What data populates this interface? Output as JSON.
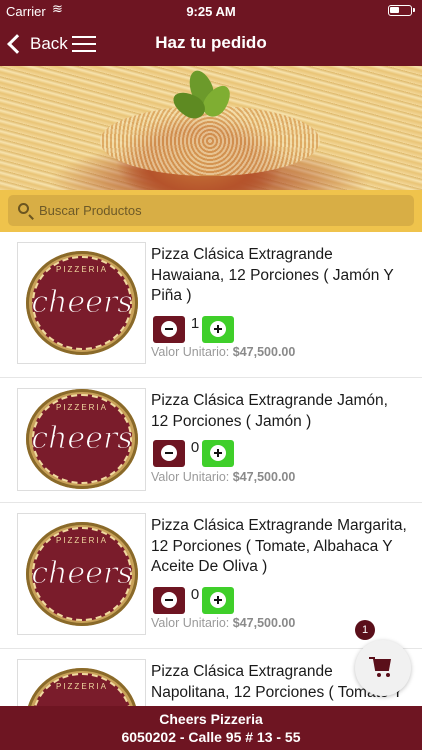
{
  "status_bar": {
    "carrier": "Carrier",
    "time": "9:25 AM",
    "wifi_icon": "wifi-icon",
    "battery_icon": "battery-icon"
  },
  "nav": {
    "back_label": "Back",
    "title": "Haz tu pedido"
  },
  "search": {
    "placeholder": "Buscar Productos"
  },
  "logo": {
    "text": "cheers",
    "subtext": "PIZZERIA"
  },
  "products": [
    {
      "name": "Pizza Clásica Extragrande Hawaiana, 12 Porciones ( Jamón Y Piña )",
      "quantity": "1",
      "price_label": "Valor Unitario:",
      "price": "$47,500.00"
    },
    {
      "name": "Pizza Clásica Extragrande Jamón, 12 Porciones ( Jamón )",
      "quantity": "0",
      "price_label": "Valor Unitario:",
      "price": "$47,500.00"
    },
    {
      "name": "Pizza Clásica Extragrande Margarita, 12 Porciones ( Tomate, Albahaca Y Aceite De Oliva )",
      "quantity": "0",
      "price_label": "Valor Unitario:",
      "price": "$47,500.00"
    },
    {
      "name": "Pizza Clásica Extragrande Napolitana, 12 Porciones ( Tomate Y",
      "quantity": "",
      "price_label": "",
      "price": ""
    }
  ],
  "cart": {
    "count": "1",
    "icon": "cart-icon"
  },
  "footer": {
    "line1": "Cheers Pizzeria",
    "line2": "6050202 - Calle 95 # 13 - 55"
  },
  "colors": {
    "primary": "#6e1522",
    "accent": "#efc34c",
    "plus": "#3fcf2a"
  }
}
